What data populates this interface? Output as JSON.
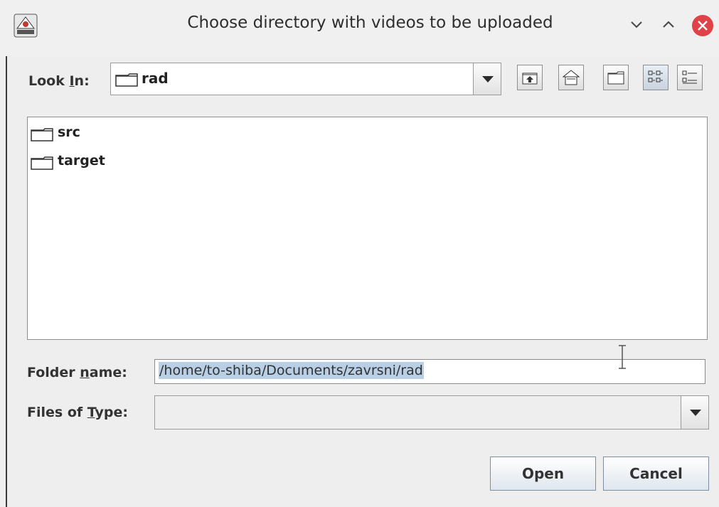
{
  "window": {
    "title": "Choose directory with videos to be uploaded",
    "controls": [
      "minimize",
      "maximize",
      "close"
    ],
    "close_color": "#e0424a"
  },
  "look_in": {
    "label_pre": "Look ",
    "label_key": "I",
    "label_post": "n:",
    "value": "rad"
  },
  "toolbar": [
    "up-one-level-icon",
    "home-icon",
    "new-folder-icon",
    "list-view-icon",
    "details-view-icon"
  ],
  "files": [
    {
      "name": "src",
      "icon": "folder-icon"
    },
    {
      "name": "target",
      "icon": "folder-icon"
    }
  ],
  "folder_name": {
    "label_pre": "Folder ",
    "label_key": "n",
    "label_post": "ame:",
    "value": "/home/to-shiba/Documents/zavrsni/rad"
  },
  "files_of_type": {
    "label_pre": "Files of ",
    "label_key": "T",
    "label_post": "ype:",
    "value": ""
  },
  "buttons": {
    "open": "Open",
    "cancel": "Cancel"
  },
  "colors": {
    "selection": "#b8cfe5",
    "button_border": "#7e8ea0"
  }
}
